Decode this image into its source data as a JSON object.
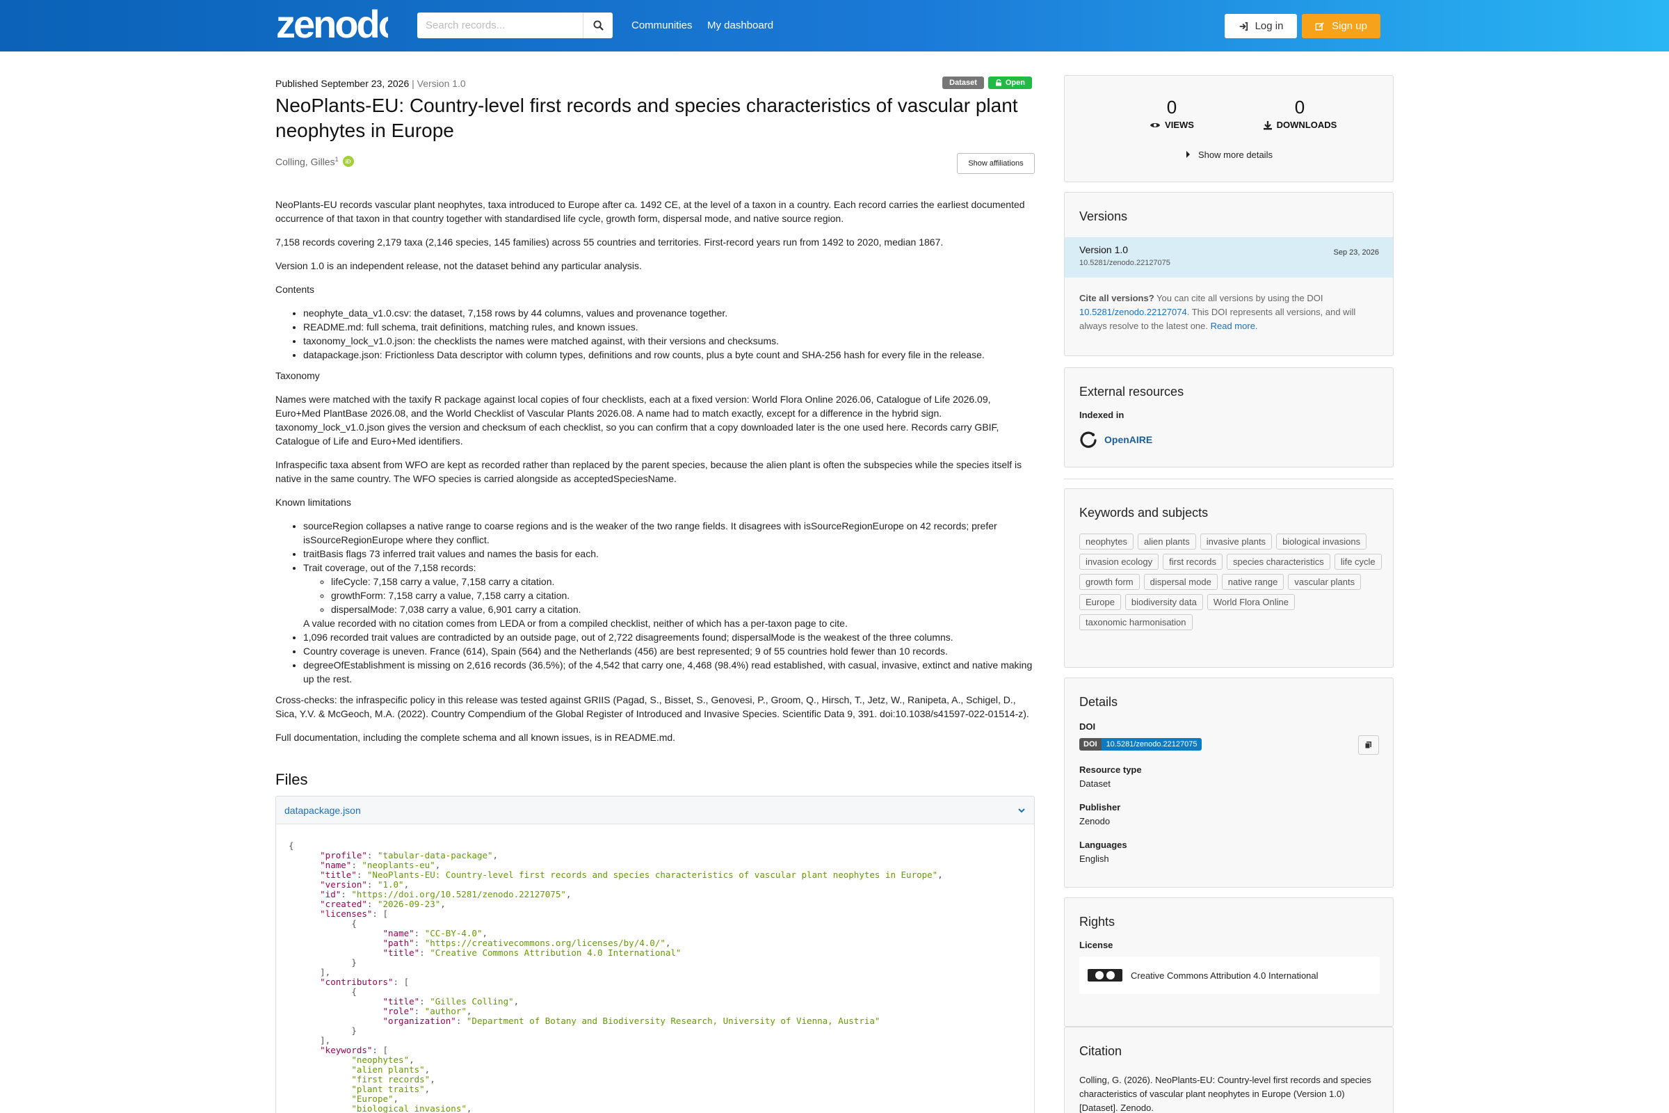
{
  "header": {
    "logo": "zenodo",
    "search_placeholder": "Search records...",
    "nav": [
      "Communities",
      "My dashboard"
    ],
    "login": "Log in",
    "signup": "Sign up"
  },
  "record": {
    "published": "Published September 23, 2026",
    "sep": " | ",
    "version": "Version 1.0",
    "badges": [
      "Dataset",
      "Open"
    ],
    "title": "NeoPlants-EU: Country-level first records and species characteristics of vascular plant neophytes in Europe",
    "creator": "Colling, Gilles",
    "creator_sup": "1",
    "orcid": "iD",
    "show_affiliations": "Show affiliations"
  },
  "description": {
    "p1": "NeoPlants-EU records vascular plant neophytes, taxa introduced to Europe after ca. 1492 CE, at the level of a taxon in a country. Each record carries the earliest documented occurrence of that taxon in that country together with standardised life cycle, growth form, dispersal mode, and native source region.",
    "p2": "7,158 records covering 2,179 taxa (2,146 species, 145 families) across 55 countries and territories. First-record years run from 1492 to 2020, median 1867.",
    "p3": "Version 1.0 is an independent release, not the dataset behind any particular analysis.",
    "contents_h": "Contents",
    "contents": [
      "neophyte_data_v1.0.csv: the dataset, 7,158 rows by 44 columns, values and provenance together.",
      "README.md: full schema, trait definitions, matching rules, and known issues.",
      "taxonomy_lock_v1.0.json: the checklists the names were matched against, with their versions and checksums.",
      "datapackage.json: Frictionless Data descriptor with column types, definitions and row counts, plus a byte count and SHA-256 hash for every file in the release."
    ],
    "taxonomy_h": "Taxonomy",
    "taxonomy_p1": "Names were matched with the taxify R package against local copies of four checklists, each at a fixed version: World Flora Online 2026.06, Catalogue of Life 2026.09, Euro+Med PlantBase 2026.08, and the World Checklist of Vascular Plants 2026.08. A name had to match exactly, except for a difference in the hybrid sign. taxonomy_lock_v1.0.json gives the version and checksum of each checklist, so you can confirm that a copy downloaded later is the one used here. Records carry GBIF, Catalogue of Life and Euro+Med identifiers.",
    "taxonomy_p2": "Infraspecific taxa absent from WFO are kept as recorded rather than replaced by the parent species, because the alien plant is often the subspecies while the species itself is native in the same country. The WFO species is carried alongside as acceptedSpeciesName.",
    "limits_h": "Known limitations",
    "limit1": "sourceRegion collapses a native range to coarse regions and is the weaker of the two range fields. It disagrees with isSourceRegionEurope on 42 records; prefer isSourceRegionEurope where they conflict.",
    "limit2": "traitBasis flags 73 inferred trait values and names the basis for each.",
    "limit3": "Trait coverage, out of the 7,158 records:",
    "limit3_sub": [
      "lifeCycle: 7,158 carry a value, 7,158 carry a citation.",
      "growthForm: 7,158 carry a value, 7,158 carry a citation.",
      "dispersalMode: 7,038 carry a value, 6,901 carry a citation."
    ],
    "limit3_note": "A value recorded with no citation comes from LEDA or from a compiled checklist, neither of which has a per-taxon page to cite.",
    "limit4": "1,096 recorded trait values are contradicted by an outside page, out of 2,722 disagreements found; dispersalMode is the weakest of the three columns.",
    "limit5": "Country coverage is uneven. France (614), Spain (564) and the Netherlands (456) are best represented; 9 of 55 countries hold fewer than 10 records.",
    "limit6": "degreeOfEstablishment is missing on 2,616 records (36.5%); of the 4,542 that carry one, 4,468 (98.4%) read established, with casual, invasive, extinct and native making up the rest.",
    "crosscheck": "Cross-checks: the infraspecific policy in this release was tested against GRIIS (Pagad, S., Bisset, S., Genovesi, P., Groom, Q., Hirsch, T., Jetz, W., Ranipeta, A., Schigel, D., Sica, Y.V. & McGeoch, M.A. (2022). Country Compendium of the Global Register of Introduced and Invasive Species. Scientific Data 9, 391. doi:10.1038/s41597-022-01514-z).",
    "fulldoc": "Full documentation, including the complete schema and all known issues, is in README.md."
  },
  "files": {
    "heading": "Files",
    "filename": "datapackage.json",
    "json_lines": [
      {
        "indent": 0,
        "key": "",
        "val": "",
        "raw": "{"
      },
      {
        "indent": 1,
        "key": "\"profile\"",
        "val": "\"tabular-data-package\"",
        "tail": ","
      },
      {
        "indent": 1,
        "key": "\"name\"",
        "val": "\"neoplants-eu\"",
        "tail": ","
      },
      {
        "indent": 1,
        "key": "\"title\"",
        "val": "\"NeoPlants-EU: Country-level first records and species characteristics of vascular plant neophytes in Europe\"",
        "tail": ","
      },
      {
        "indent": 1,
        "key": "\"version\"",
        "val": "\"1.0\"",
        "tail": ","
      },
      {
        "indent": 1,
        "key": "\"id\"",
        "val": "\"https://doi.org/10.5281/zenodo.22127075\"",
        "tail": ","
      },
      {
        "indent": 1,
        "key": "\"created\"",
        "val": "\"2026-09-23\"",
        "tail": ","
      },
      {
        "indent": 1,
        "key": "\"licenses\"",
        "val": "",
        "tail": "",
        "raw_after": "["
      },
      {
        "indent": 2,
        "key": "",
        "val": "",
        "raw": "{"
      },
      {
        "indent": 3,
        "key": "\"name\"",
        "val": "\"CC-BY-4.0\"",
        "tail": ","
      },
      {
        "indent": 3,
        "key": "\"path\"",
        "val": "\"https://creativecommons.org/licenses/by/4.0/\"",
        "tail": ","
      },
      {
        "indent": 3,
        "key": "\"title\"",
        "val": "\"Creative Commons Attribution 4.0 International\"",
        "tail": ""
      },
      {
        "indent": 2,
        "key": "",
        "val": "",
        "raw": "}"
      },
      {
        "indent": 1,
        "key": "",
        "val": "",
        "raw": "],"
      },
      {
        "indent": 1,
        "key": "\"contributors\"",
        "val": "",
        "tail": "",
        "raw_after": "["
      },
      {
        "indent": 2,
        "key": "",
        "val": "",
        "raw": "{"
      },
      {
        "indent": 3,
        "key": "\"title\"",
        "val": "\"Gilles Colling\"",
        "tail": ","
      },
      {
        "indent": 3,
        "key": "\"role\"",
        "val": "\"author\"",
        "tail": ","
      },
      {
        "indent": 3,
        "key": "\"organization\"",
        "val": "\"Department of Botany and Biodiversity Research, University of Vienna, Austria\"",
        "tail": ""
      },
      {
        "indent": 2,
        "key": "",
        "val": "",
        "raw": "}"
      },
      {
        "indent": 1,
        "key": "",
        "val": "",
        "raw": "],"
      },
      {
        "indent": 1,
        "key": "\"keywords\"",
        "val": "",
        "tail": "",
        "raw_after": "["
      },
      {
        "indent": 2,
        "key": "",
        "val": "\"neophytes\"",
        "tail": ","
      },
      {
        "indent": 2,
        "key": "",
        "val": "\"alien plants\"",
        "tail": ","
      },
      {
        "indent": 2,
        "key": "",
        "val": "\"first records\"",
        "tail": ","
      },
      {
        "indent": 2,
        "key": "",
        "val": "\"plant traits\"",
        "tail": ","
      },
      {
        "indent": 2,
        "key": "",
        "val": "\"Europe\"",
        "tail": ","
      },
      {
        "indent": 2,
        "key": "",
        "val": "\"biological invasions\"",
        "tail": ","
      }
    ]
  },
  "sidebar": {
    "views": "0",
    "views_label": "VIEWS",
    "downloads": "0",
    "downloads_label": "DOWNLOADS",
    "more": "Show more details",
    "versions_h": "Versions",
    "ver_name": "Version 1.0",
    "ver_date": "Sep 23, 2026",
    "ver_doi": "10.5281/zenodo.22127075",
    "cite_bold": "Cite all versions?",
    "cite_text1": " You can cite all versions by using the DOI ",
    "cite_link": "10.5281/zenodo.22127074",
    "cite_text2": ". This DOI represents all versions, and will always resolve to the latest one. ",
    "cite_more": "Read more.",
    "ext_h": "External resources",
    "indexed": "Indexed in",
    "openaire": "OpenAIRE",
    "kw_h": "Keywords and subjects",
    "keywords": [
      "neophytes",
      "alien plants",
      "invasive plants",
      "biological invasions",
      "invasion ecology",
      "first records",
      "species characteristics",
      "life cycle",
      "growth form",
      "dispersal mode",
      "native range",
      "vascular plants",
      "Europe",
      "biodiversity data",
      "World Flora Online",
      "taxonomic harmonisation"
    ],
    "details_h": "Details",
    "doi_label": "DOI",
    "doi_a": "DOI",
    "doi_b": "10.5281/zenodo.22127075",
    "rt_label": "Resource type",
    "rt_val": "Dataset",
    "pub_label": "Publisher",
    "pub_val": "Zenodo",
    "lang_label": "Languages",
    "lang_val": "English",
    "rights_h": "Rights",
    "license_label": "License",
    "license_val": "Creative Commons Attribution 4.0 International",
    "citation_h": "Citation",
    "citation_text": "Colling, G. (2026). NeoPlants-EU: Country-level first records and species characteristics of vascular plant neophytes in Europe (Version 1.0) [Dataset]. Zenodo."
  }
}
